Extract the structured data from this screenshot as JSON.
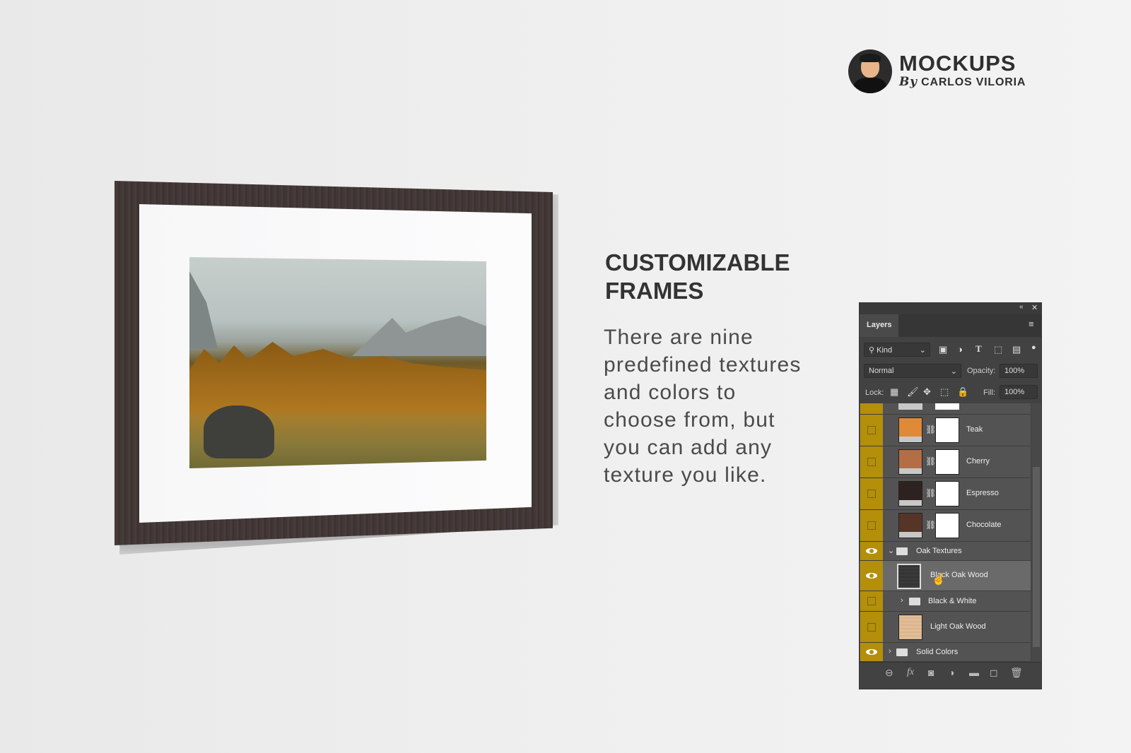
{
  "logo": {
    "title": "MOCKUPS",
    "by": "By",
    "author": "CARLOS VILORIA"
  },
  "headline": "CUSTOMIZABLE FRAMES",
  "body": "There are nine predefined textures and colors to choose from, but you can add any texture you like.",
  "panel": {
    "tab": "Layers",
    "filter": "Kind",
    "blend_mode": "Normal",
    "opacity_label": "Opacity:",
    "opacity": "100%",
    "lock_label": "Lock:",
    "fill_label": "Fill:",
    "fill": "100%",
    "accent": "#b38f0a",
    "layers": [
      {
        "name": "Teak",
        "color": "#e08a38",
        "visible": false
      },
      {
        "name": "Cherry",
        "color": "#b36e46",
        "visible": false
      },
      {
        "name": "Espresso",
        "color": "#2e2220",
        "visible": false
      },
      {
        "name": "Chocolate",
        "color": "#563528",
        "visible": false
      },
      {
        "name": "Oak Textures",
        "type": "group",
        "expanded": true,
        "visible": true
      },
      {
        "name": "Black Oak Wood",
        "color": "#3a3a3a",
        "visible": true,
        "selected": true
      },
      {
        "name": "Black & White",
        "type": "group",
        "expanded": false,
        "visible": false
      },
      {
        "name": "Light Oak Wood",
        "color": "#dcb58e",
        "visible": false
      },
      {
        "name": "Solid Colors",
        "type": "group",
        "expanded": false,
        "visible": true
      }
    ]
  }
}
